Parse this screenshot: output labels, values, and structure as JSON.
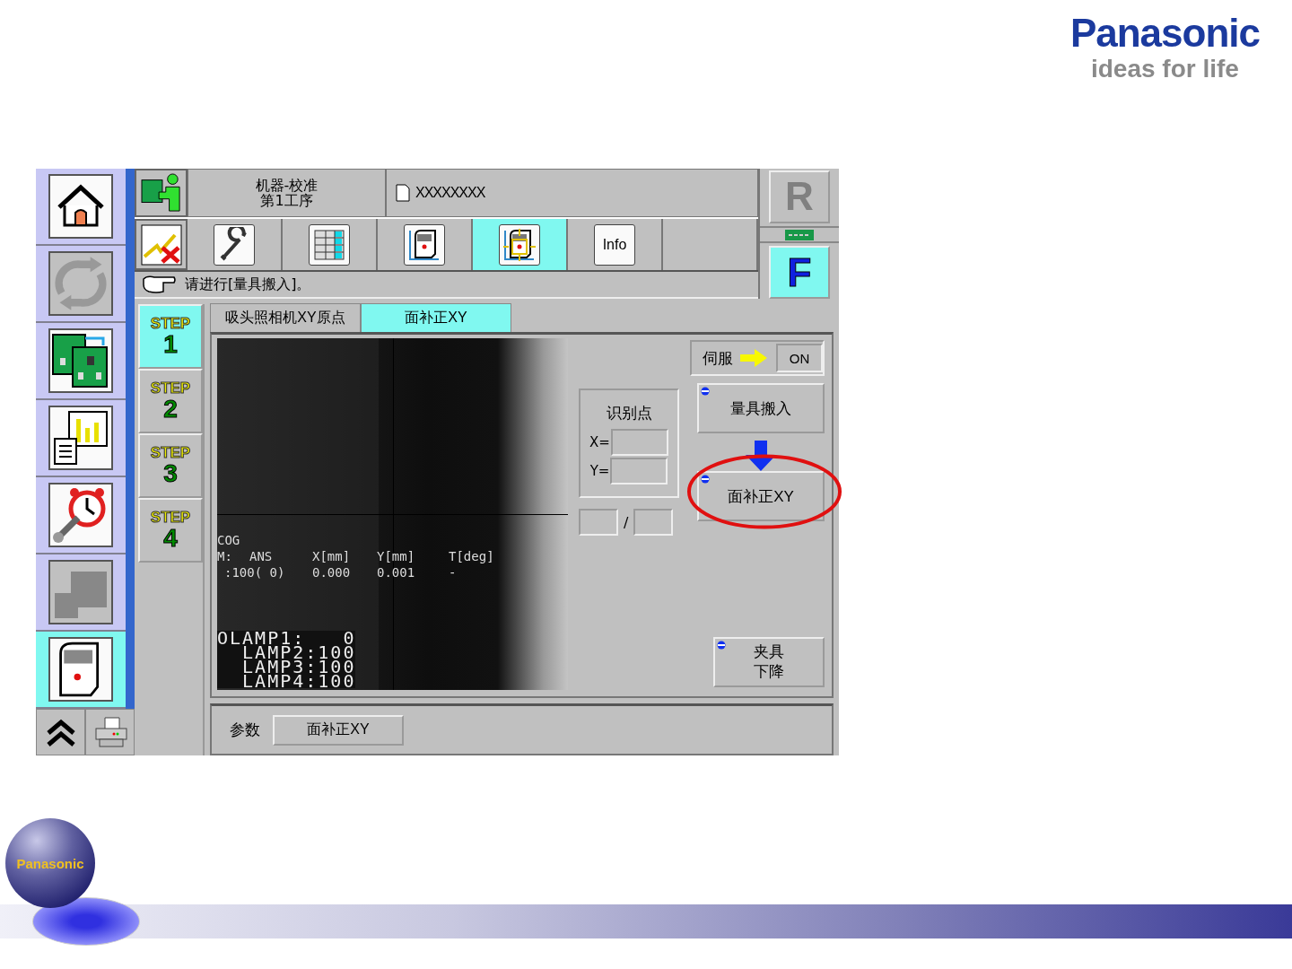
{
  "slide": {
    "brand": "Panasonic",
    "tagline": "ideas for life",
    "globe_label": "Panasonic"
  },
  "nav": [
    {
      "kind": "home",
      "selected": false,
      "disabled": false
    },
    {
      "kind": "cycle",
      "selected": false,
      "disabled": true
    },
    {
      "kind": "boards",
      "selected": false,
      "disabled": false
    },
    {
      "kind": "chart",
      "selected": false,
      "disabled": false
    },
    {
      "kind": "alarm",
      "selected": false,
      "disabled": false
    },
    {
      "kind": "blocks",
      "selected": false,
      "disabled": true
    },
    {
      "kind": "machine",
      "selected": true,
      "disabled": false
    }
  ],
  "nav_bottom": [
    {
      "kind": "chevrons"
    },
    {
      "kind": "printer"
    }
  ],
  "header": {
    "title_lines": [
      "机器-校准",
      "第1工序"
    ],
    "file": "XXXXXXXX",
    "r_button": {
      "label": "R",
      "disabled": true
    },
    "f_button": {
      "label": "F",
      "selected": true
    }
  },
  "toolbar": [
    {
      "kind": "wrench",
      "selected": false
    },
    {
      "kind": "grid",
      "selected": false
    },
    {
      "kind": "machine",
      "selected": false
    },
    {
      "kind": "machine-move",
      "selected": true
    },
    {
      "kind": "info",
      "selected": false,
      "label": "Info"
    },
    {
      "kind": "empty",
      "selected": false
    }
  ],
  "message": "请进行[量具搬入]。",
  "steps": [
    {
      "label": "STEP",
      "number": "1",
      "selected": true
    },
    {
      "label": "STEP",
      "number": "2",
      "selected": false
    },
    {
      "label": "STEP",
      "number": "3",
      "selected": false
    },
    {
      "label": "STEP",
      "number": "4",
      "selected": false
    }
  ],
  "tabs": [
    {
      "label": "吸头照相机XY原点",
      "selected": false
    },
    {
      "label": "面补正XY",
      "selected": true
    }
  ],
  "camera": {
    "title": "COG",
    "headers": [
      "M:",
      "ANS",
      "X[mm]",
      "Y[mm]",
      "T[deg]"
    ],
    "values": [
      ":100( 0)",
      "0.000",
      "0.001",
      "-"
    ],
    "lamp_lines": [
      "OLAMP1:   0",
      "  LAMP2:100",
      "  LAMP3:100",
      "  LAMP4:100"
    ]
  },
  "servo": {
    "label": "伺服",
    "value": "ON"
  },
  "recognition": {
    "title": "识别点",
    "x_label": "X=",
    "y_label": "Y=",
    "separator": "/"
  },
  "actions": [
    {
      "kind": "action",
      "label": "量具搬入",
      "highlighted": false
    },
    {
      "kind": "action",
      "label": "面补正XY",
      "highlighted": true
    },
    {
      "kind": "small",
      "label": "夹具下降",
      "highlighted": false
    }
  ],
  "params": {
    "label": "参数",
    "button": "面补正XY"
  }
}
